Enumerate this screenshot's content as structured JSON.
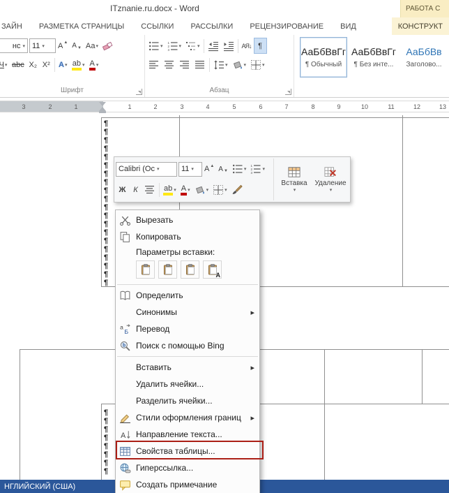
{
  "title_bar": {
    "title": "ITznanie.ru.docx - Word",
    "contextual_label": "РАБОТА С"
  },
  "tabs": [
    "ЗАЙН",
    "РАЗМЕТКА СТРАНИЦЫ",
    "ССЫЛКИ",
    "РАССЫЛКИ",
    "РЕЦЕНЗИРОВАНИЕ",
    "ВИД",
    "КОНСТРУКТ"
  ],
  "ribbon": {
    "font": {
      "group_label": "Шрифт",
      "font_name_partial": "нс",
      "font_size": "11",
      "grow_font": "А",
      "shrink_font": "А",
      "change_case": "Аа",
      "underline_partial": "Ч",
      "strikethrough": "abc",
      "subscript": "X₂",
      "superscript": "X²",
      "text_effects": "А",
      "highlight": "ab",
      "font_color": "А"
    },
    "paragraph": {
      "group_label": "Абзац",
      "sort": "АЯ↓",
      "show_marks": "¶"
    },
    "styles": [
      {
        "preview": "АаБбВвГг",
        "name": "¶ Обычный"
      },
      {
        "preview": "АаБбВвГг",
        "name": "¶ Без инте..."
      },
      {
        "preview": "АаБбВв",
        "name": "Заголово..."
      }
    ]
  },
  "ruler": {
    "left_numbers": [
      "3",
      "2",
      "1"
    ],
    "page_numbers": [
      "1",
      "2",
      "3",
      "4",
      "5",
      "6",
      "7",
      "8",
      "9",
      "10",
      "11",
      "12",
      "13"
    ]
  },
  "mini_toolbar": {
    "font_name": "Calibri (Ос",
    "font_size": "11",
    "grow_font": "А",
    "shrink_font": "А",
    "bold": "Ж",
    "italic": "К",
    "highlight": "ab",
    "font_color": "А",
    "insert_label": "Вставка",
    "delete_label": "Удаление"
  },
  "context_menu": {
    "items": [
      "Вырезать",
      "Копировать",
      "Параметры вставки:",
      "Определить",
      "Синонимы",
      "Перевод",
      "Поиск с помощью Bing",
      "Вставить",
      "Удалить ячейки...",
      "Разделить ячейки...",
      "Стили оформления границ",
      "Направление текста...",
      "Свойства таблицы...",
      "Гиперссылка...",
      "Создать примечание"
    ],
    "paste_text_letter": "A"
  },
  "document": {
    "pilcrow": "¶"
  },
  "status_bar": {
    "language": "НГЛИЙСКИЙ (США)"
  },
  "colors": {
    "accent": "#2b579a",
    "annotation_box": "#ab1f16",
    "contextual_tab_bg": "#fbf3d5"
  }
}
